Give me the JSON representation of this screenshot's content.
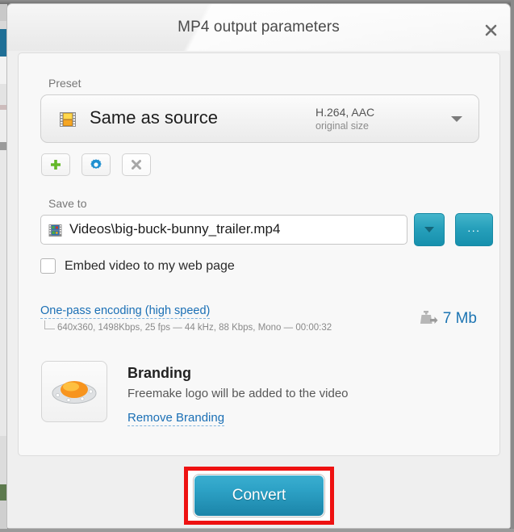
{
  "window": {
    "title": "MP4 output parameters",
    "close_icon": "close-icon"
  },
  "preset": {
    "label": "Preset",
    "icon": "film-strip-icon",
    "name": "Same as source",
    "codec": "H.264, AAC",
    "size": "original size",
    "caret_icon": "chevron-down-icon",
    "buttons": [
      {
        "name": "add-preset-button",
        "icon": "plus-icon"
      },
      {
        "name": "edit-preset-button",
        "icon": "gear-icon"
      },
      {
        "name": "delete-preset-button",
        "icon": "close-x-icon"
      }
    ]
  },
  "save_to": {
    "label": "Save to",
    "icon": "video-file-icon",
    "path": "Videos\\big-buck-bunny_trailer.mp4",
    "dropdown_icon": "chevron-down-icon",
    "browse_label": "...",
    "embed_checkbox_label": "Embed video to my web page",
    "embed_checked": false
  },
  "encoding": {
    "link": "One-pass encoding (high speed)",
    "detail": "640x360, 1498Kbps, 25 fps — 44 kHz, 88 Kbps, Mono — 00:00:32",
    "size_icon": "output-size-icon",
    "size_value": "7 Mb"
  },
  "branding": {
    "logo_icon": "freemake-ufo-logo-icon",
    "title": "Branding",
    "description": "Freemake logo will be added to the video",
    "remove_link": "Remove Branding"
  },
  "footer": {
    "convert_label": "Convert"
  },
  "colors": {
    "accent_teal": "#1b84a8",
    "link_blue": "#1a6fb5",
    "highlight_red": "#ee1111",
    "size_blue": "#1d75b3"
  }
}
